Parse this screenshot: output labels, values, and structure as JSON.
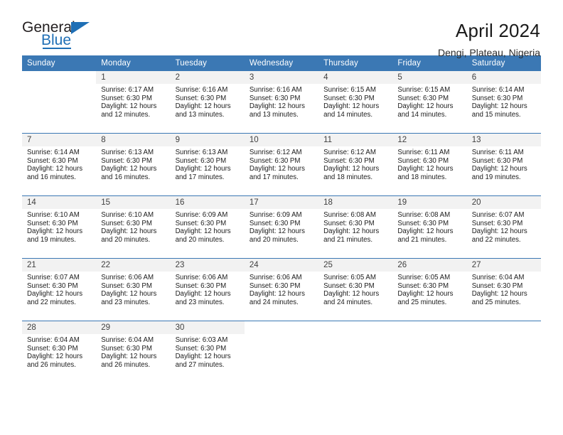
{
  "brand": {
    "name_part1": "General",
    "name_part2": "Blue",
    "triangle_icon": "blue-triangle-icon",
    "accent_color": "#1f6fb5"
  },
  "header": {
    "title": "April 2024",
    "subtitle": "Dengi, Plateau, Nigeria"
  },
  "colors": {
    "header_blue": "#3b78b4",
    "daynum_band": "#f2f2f2",
    "text": "#1c1c1c"
  },
  "weekday_headers": [
    "Sunday",
    "Monday",
    "Tuesday",
    "Wednesday",
    "Thursday",
    "Friday",
    "Saturday"
  ],
  "weeks": [
    [
      {
        "empty": true
      },
      {
        "day": "1",
        "sunrise": "Sunrise: 6:17 AM",
        "sunset": "Sunset: 6:30 PM",
        "daylight1": "Daylight: 12 hours",
        "daylight2": "and 12 minutes."
      },
      {
        "day": "2",
        "sunrise": "Sunrise: 6:16 AM",
        "sunset": "Sunset: 6:30 PM",
        "daylight1": "Daylight: 12 hours",
        "daylight2": "and 13 minutes."
      },
      {
        "day": "3",
        "sunrise": "Sunrise: 6:16 AM",
        "sunset": "Sunset: 6:30 PM",
        "daylight1": "Daylight: 12 hours",
        "daylight2": "and 13 minutes."
      },
      {
        "day": "4",
        "sunrise": "Sunrise: 6:15 AM",
        "sunset": "Sunset: 6:30 PM",
        "daylight1": "Daylight: 12 hours",
        "daylight2": "and 14 minutes."
      },
      {
        "day": "5",
        "sunrise": "Sunrise: 6:15 AM",
        "sunset": "Sunset: 6:30 PM",
        "daylight1": "Daylight: 12 hours",
        "daylight2": "and 14 minutes."
      },
      {
        "day": "6",
        "sunrise": "Sunrise: 6:14 AM",
        "sunset": "Sunset: 6:30 PM",
        "daylight1": "Daylight: 12 hours",
        "daylight2": "and 15 minutes."
      }
    ],
    [
      {
        "day": "7",
        "sunrise": "Sunrise: 6:14 AM",
        "sunset": "Sunset: 6:30 PM",
        "daylight1": "Daylight: 12 hours",
        "daylight2": "and 16 minutes."
      },
      {
        "day": "8",
        "sunrise": "Sunrise: 6:13 AM",
        "sunset": "Sunset: 6:30 PM",
        "daylight1": "Daylight: 12 hours",
        "daylight2": "and 16 minutes."
      },
      {
        "day": "9",
        "sunrise": "Sunrise: 6:13 AM",
        "sunset": "Sunset: 6:30 PM",
        "daylight1": "Daylight: 12 hours",
        "daylight2": "and 17 minutes."
      },
      {
        "day": "10",
        "sunrise": "Sunrise: 6:12 AM",
        "sunset": "Sunset: 6:30 PM",
        "daylight1": "Daylight: 12 hours",
        "daylight2": "and 17 minutes."
      },
      {
        "day": "11",
        "sunrise": "Sunrise: 6:12 AM",
        "sunset": "Sunset: 6:30 PM",
        "daylight1": "Daylight: 12 hours",
        "daylight2": "and 18 minutes."
      },
      {
        "day": "12",
        "sunrise": "Sunrise: 6:11 AM",
        "sunset": "Sunset: 6:30 PM",
        "daylight1": "Daylight: 12 hours",
        "daylight2": "and 18 minutes."
      },
      {
        "day": "13",
        "sunrise": "Sunrise: 6:11 AM",
        "sunset": "Sunset: 6:30 PM",
        "daylight1": "Daylight: 12 hours",
        "daylight2": "and 19 minutes."
      }
    ],
    [
      {
        "day": "14",
        "sunrise": "Sunrise: 6:10 AM",
        "sunset": "Sunset: 6:30 PM",
        "daylight1": "Daylight: 12 hours",
        "daylight2": "and 19 minutes."
      },
      {
        "day": "15",
        "sunrise": "Sunrise: 6:10 AM",
        "sunset": "Sunset: 6:30 PM",
        "daylight1": "Daylight: 12 hours",
        "daylight2": "and 20 minutes."
      },
      {
        "day": "16",
        "sunrise": "Sunrise: 6:09 AM",
        "sunset": "Sunset: 6:30 PM",
        "daylight1": "Daylight: 12 hours",
        "daylight2": "and 20 minutes."
      },
      {
        "day": "17",
        "sunrise": "Sunrise: 6:09 AM",
        "sunset": "Sunset: 6:30 PM",
        "daylight1": "Daylight: 12 hours",
        "daylight2": "and 20 minutes."
      },
      {
        "day": "18",
        "sunrise": "Sunrise: 6:08 AM",
        "sunset": "Sunset: 6:30 PM",
        "daylight1": "Daylight: 12 hours",
        "daylight2": "and 21 minutes."
      },
      {
        "day": "19",
        "sunrise": "Sunrise: 6:08 AM",
        "sunset": "Sunset: 6:30 PM",
        "daylight1": "Daylight: 12 hours",
        "daylight2": "and 21 minutes."
      },
      {
        "day": "20",
        "sunrise": "Sunrise: 6:07 AM",
        "sunset": "Sunset: 6:30 PM",
        "daylight1": "Daylight: 12 hours",
        "daylight2": "and 22 minutes."
      }
    ],
    [
      {
        "day": "21",
        "sunrise": "Sunrise: 6:07 AM",
        "sunset": "Sunset: 6:30 PM",
        "daylight1": "Daylight: 12 hours",
        "daylight2": "and 22 minutes."
      },
      {
        "day": "22",
        "sunrise": "Sunrise: 6:06 AM",
        "sunset": "Sunset: 6:30 PM",
        "daylight1": "Daylight: 12 hours",
        "daylight2": "and 23 minutes."
      },
      {
        "day": "23",
        "sunrise": "Sunrise: 6:06 AM",
        "sunset": "Sunset: 6:30 PM",
        "daylight1": "Daylight: 12 hours",
        "daylight2": "and 23 minutes."
      },
      {
        "day": "24",
        "sunrise": "Sunrise: 6:06 AM",
        "sunset": "Sunset: 6:30 PM",
        "daylight1": "Daylight: 12 hours",
        "daylight2": "and 24 minutes."
      },
      {
        "day": "25",
        "sunrise": "Sunrise: 6:05 AM",
        "sunset": "Sunset: 6:30 PM",
        "daylight1": "Daylight: 12 hours",
        "daylight2": "and 24 minutes."
      },
      {
        "day": "26",
        "sunrise": "Sunrise: 6:05 AM",
        "sunset": "Sunset: 6:30 PM",
        "daylight1": "Daylight: 12 hours",
        "daylight2": "and 25 minutes."
      },
      {
        "day": "27",
        "sunrise": "Sunrise: 6:04 AM",
        "sunset": "Sunset: 6:30 PM",
        "daylight1": "Daylight: 12 hours",
        "daylight2": "and 25 minutes."
      }
    ],
    [
      {
        "day": "28",
        "sunrise": "Sunrise: 6:04 AM",
        "sunset": "Sunset: 6:30 PM",
        "daylight1": "Daylight: 12 hours",
        "daylight2": "and 26 minutes."
      },
      {
        "day": "29",
        "sunrise": "Sunrise: 6:04 AM",
        "sunset": "Sunset: 6:30 PM",
        "daylight1": "Daylight: 12 hours",
        "daylight2": "and 26 minutes."
      },
      {
        "day": "30",
        "sunrise": "Sunrise: 6:03 AM",
        "sunset": "Sunset: 6:30 PM",
        "daylight1": "Daylight: 12 hours",
        "daylight2": "and 27 minutes."
      },
      {
        "empty": true
      },
      {
        "empty": true
      },
      {
        "empty": true
      },
      {
        "empty": true
      }
    ]
  ]
}
